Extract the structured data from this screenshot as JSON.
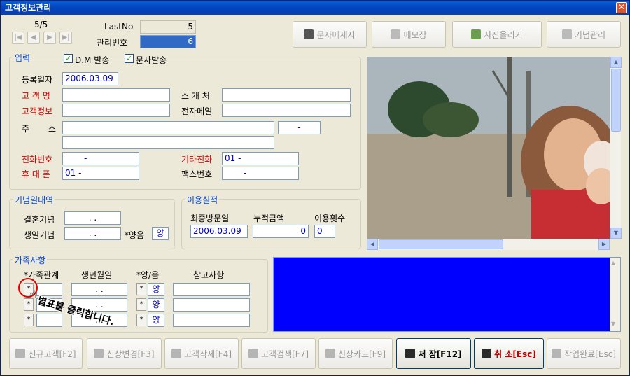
{
  "window": {
    "title": "고객정보관리",
    "close": "✕"
  },
  "nav": {
    "record": "5/5",
    "buttons": [
      "|◀",
      "◀",
      "▶",
      "▶|"
    ]
  },
  "header": {
    "lastno_label": "LastNo",
    "lastno_value": "5",
    "manage_label": "관리번호",
    "manage_value": "6"
  },
  "toolbar": {
    "sms": "문자메세지",
    "memo": "메모장",
    "photo": "사진올리기",
    "anniv": "기념관리"
  },
  "input": {
    "title": "입력",
    "dm_label": "D.M 발송",
    "sms_label": "문자발송",
    "reg_label": "등록일자",
    "reg_value": "2006.03.09",
    "name_label": "고 객 명",
    "name_value": "",
    "info_label": "고객정보",
    "info_value": "",
    "intro_label": "소 개 처",
    "intro_value": "",
    "email_label": "전자메일",
    "email_value": "",
    "addr_label1": "주",
    "addr_label2": "소",
    "zip_value": "-",
    "phone_label": "전화번호",
    "phone_value": "-",
    "other_label": "기타전화",
    "other_value": "01 -",
    "mobile_label": "휴 대 폰",
    "mobile_value": "01 -",
    "fax_label": "팩스번호",
    "fax_value": "-"
  },
  "anniv": {
    "title": "기념일내역",
    "wedding_label": "결혼기념",
    "wedding_value": ". .",
    "birth_label": "생일기념",
    "birth_value": ". .",
    "lunar_label": "*양음",
    "lunar_value": "양"
  },
  "usage": {
    "title": "이용실적",
    "last_label": "최종방문일",
    "last_value": "2006.03.09",
    "total_label": "누적금액",
    "total_value": "0",
    "count_label": "이용횟수",
    "count_value": "0"
  },
  "family": {
    "title": "가족사항",
    "headers": [
      "*가족관계",
      "생년월일",
      "*양/음",
      "참고사항"
    ],
    "rows": [
      {
        "star": "*",
        "birth": ". .",
        "star2": "*",
        "lunar": "양"
      },
      {
        "star": "*",
        "birth": ". .",
        "star2": "*",
        "lunar": "양"
      },
      {
        "star": "*",
        "birth": ". .",
        "star2": "*",
        "lunar": "양"
      }
    ],
    "annotation": "별표를 클릭합니다."
  },
  "bottom": {
    "new": "신규고객[F2]",
    "edit": "신상변경[F3]",
    "delete": "고객삭제[F4]",
    "search": "고객검색[F7]",
    "card": "신상카드[F9]",
    "save": "저 장[F12]",
    "cancel": "취 소[Esc]",
    "done": "작업완료[Esc]"
  },
  "colors": {
    "accent": "#0046D5",
    "required": "#D00000",
    "panel": "#0000FF"
  }
}
